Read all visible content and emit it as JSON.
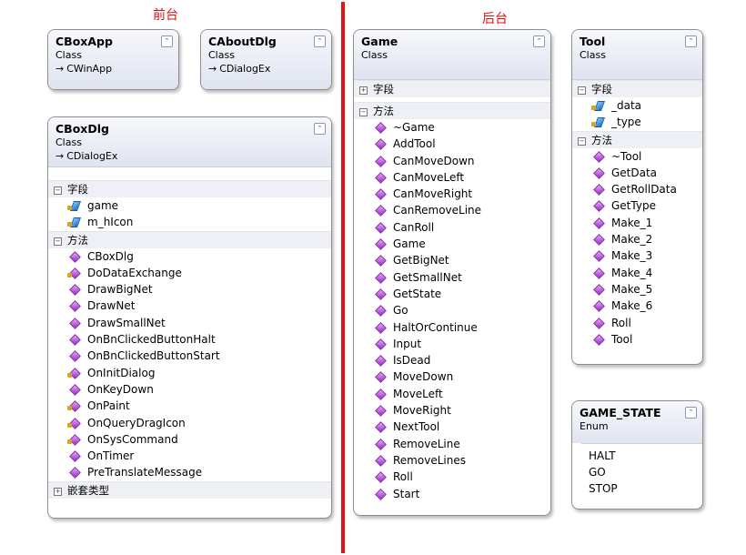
{
  "headings": {
    "front": "前台",
    "back": "后台"
  },
  "boxes": {
    "cboxapp": {
      "title": "CBoxApp",
      "kind": "Class",
      "base": "CWinApp"
    },
    "caboutdlg": {
      "title": "CAboutDlg",
      "kind": "Class",
      "base": "CDialogEx"
    },
    "cboxdlg": {
      "title": "CBoxDlg",
      "kind": "Class",
      "base": "CDialogEx",
      "fields_label": "字段",
      "fields": [
        "game",
        "m_hIcon"
      ],
      "methods_label": "方法",
      "methods": [
        "CBoxDlg",
        "DoDataExchange",
        "DrawBigNet",
        "DrawNet",
        "DrawSmallNet",
        "OnBnClickedButtonHalt",
        "OnBnClickedButtonStart",
        "OnInitDialog",
        "OnKeyDown",
        "OnPaint",
        "OnQueryDragIcon",
        "OnSysCommand",
        "OnTimer",
        "PreTranslateMessage"
      ],
      "nested_label": "嵌套类型"
    },
    "game": {
      "title": "Game",
      "kind": "Class",
      "fields_label": "字段",
      "methods_label": "方法",
      "methods": [
        "~Game",
        "AddTool",
        "CanMoveDown",
        "CanMoveLeft",
        "CanMoveRight",
        "CanRemoveLine",
        "CanRoll",
        "Game",
        "GetBigNet",
        "GetSmallNet",
        "GetState",
        "Go",
        "HaltOrContinue",
        "Input",
        "IsDead",
        "MoveDown",
        "MoveLeft",
        "MoveRight",
        "NextTool",
        "RemoveLine",
        "RemoveLines",
        "Roll",
        "Start"
      ]
    },
    "tool": {
      "title": "Tool",
      "kind": "Class",
      "fields_label": "字段",
      "fields": [
        "_data",
        "_type"
      ],
      "methods_label": "方法",
      "methods": [
        "~Tool",
        "GetData",
        "GetRollData",
        "GetType",
        "Make_1",
        "Make_2",
        "Make_3",
        "Make_4",
        "Make_5",
        "Make_6",
        "Roll",
        "Tool"
      ]
    },
    "game_state": {
      "title": "GAME_STATE",
      "kind": "Enum",
      "values": [
        "HALT",
        "GO",
        "STOP"
      ]
    }
  },
  "glyphs": {
    "collapse": "⌃",
    "expand_plus": "+",
    "collapse_minus": "−",
    "inherit_arrow": "→"
  }
}
